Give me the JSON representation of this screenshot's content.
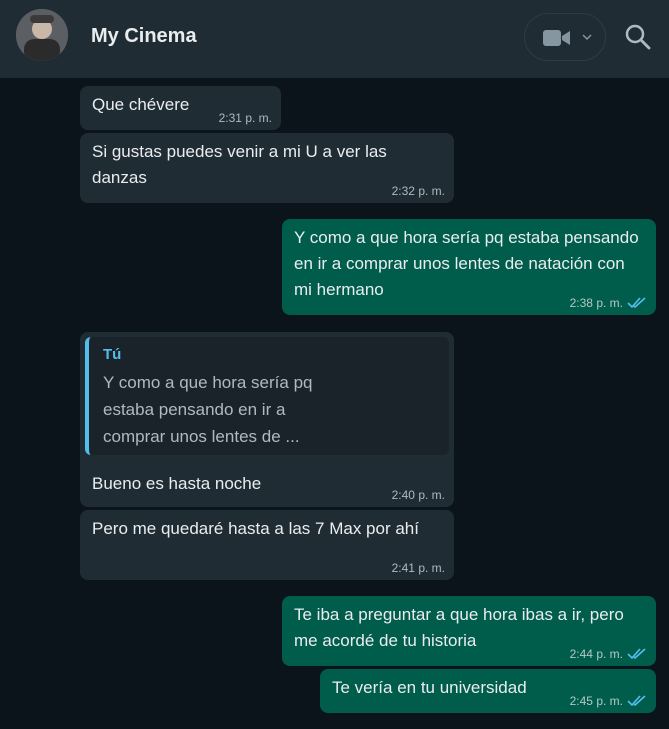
{
  "header": {
    "contact_name": "My Cinema",
    "video_call_icon": "video-camera-icon",
    "dropdown_icon": "chevron-down-icon",
    "search_icon": "search-icon"
  },
  "messages": [
    {
      "direction": "in",
      "text": "Que chévere",
      "time": "2:31 p. m."
    },
    {
      "direction": "in",
      "text": "Si gustas puedes venir a mi U a ver las danzas",
      "time": "2:32 p. m."
    },
    {
      "direction": "out",
      "text": "Y como a que hora sería pq estaba pensando en ir a comprar unos lentes de natación con mi hermano",
      "time": "2:38 p. m.",
      "status": "read"
    },
    {
      "direction": "in",
      "quote_author": "Tú",
      "quote_text": "Y como a que hora sería pq estaba pensando en ir a comprar unos lentes de ...",
      "text": "Bueno es hasta noche",
      "time": "2:40 p. m."
    },
    {
      "direction": "in",
      "text": "Pero me quedaré hasta a las 7 Max por ahí",
      "time": "2:41 p. m."
    },
    {
      "direction": "out",
      "text": "Te iba a preguntar a que hora ibas a ir, pero me acordé de tu historia",
      "time": "2:44 p. m.",
      "status": "read"
    },
    {
      "direction": "out",
      "text": "Te vería en tu universidad",
      "time": "2:45 p. m.",
      "status": "read"
    }
  ],
  "colors": {
    "background": "#0b141a",
    "header": "#202c33",
    "incoming_bubble": "#202c33",
    "outgoing_bubble": "#005c4b",
    "read_ticks": "#53bdeb",
    "quote_accent": "#53bdeb"
  }
}
